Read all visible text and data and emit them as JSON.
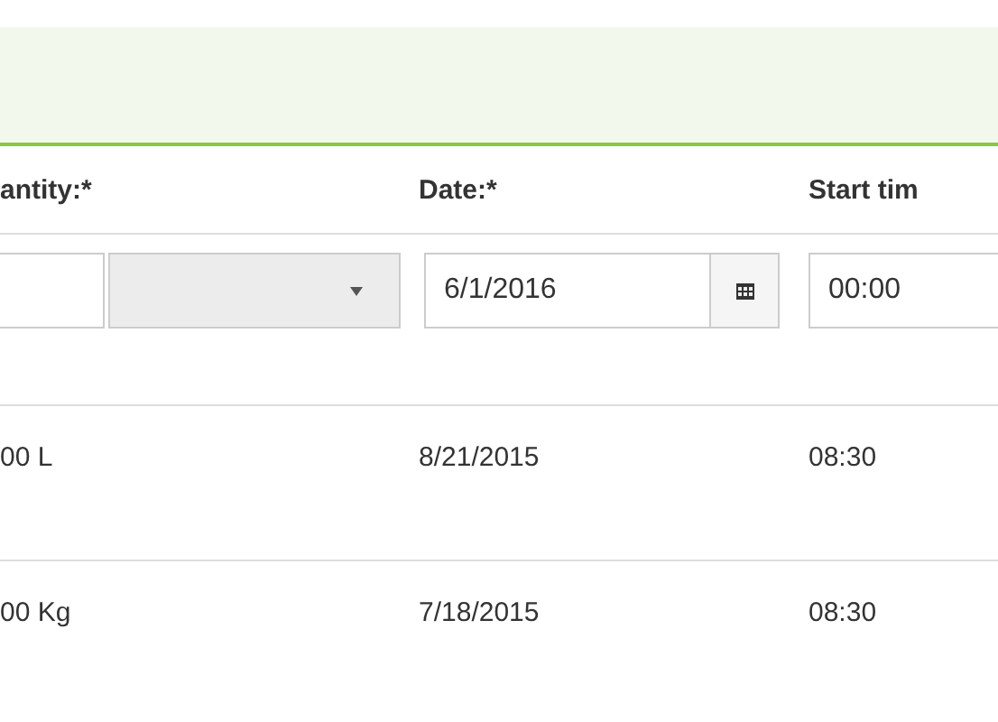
{
  "columns": [
    "antity:*",
    "Date:*",
    "Start tim"
  ],
  "inputs": {
    "date": "6/1/2016",
    "time": "00:00"
  },
  "rows": [
    {
      "quantity": "00 L",
      "date": "8/21/2015",
      "time": "08:30"
    },
    {
      "quantity": "00 Kg",
      "date": "7/18/2015",
      "time": "08:30"
    }
  ]
}
